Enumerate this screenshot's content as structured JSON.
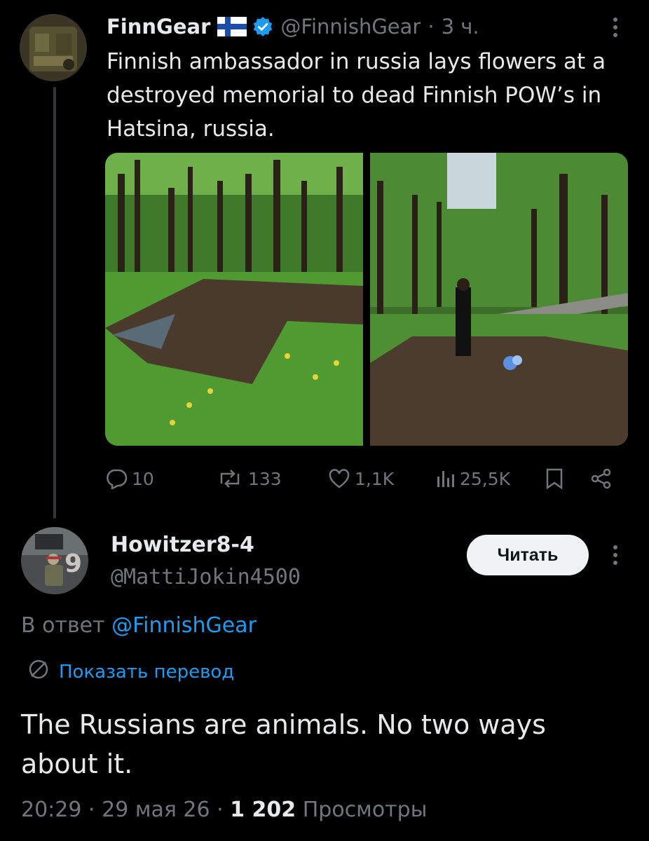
{
  "tweet": {
    "author_name": "FinnGear",
    "handle": "@FinnishGear",
    "time": "3 ч.",
    "separator": "·",
    "text": "Finnish ambassador in russia lays flowers at a destroyed memorial to dead Finnish POW’s in Hatsina, russia.",
    "stats": {
      "replies": "10",
      "reposts": "133",
      "likes": "1,1K",
      "views": "25,5K"
    }
  },
  "reply": {
    "author_name": "Howitzer8-4",
    "handle": "@MattiJokin4500",
    "follow_label": "Читать",
    "reply_prefix": "В ответ",
    "reply_to_handle": "@FinnishGear",
    "show_translation_label": "Показать перевод",
    "text": "The Russians are animals. No two ways about it.",
    "time": "20:29",
    "date": "29 мая 26",
    "views_count": "1 202",
    "views_label": "Просмотры",
    "separator": "·"
  },
  "icons": {
    "more": "more-dots-icon",
    "verified": "verified-badge-icon",
    "flag": "finland-flag-icon",
    "reply": "reply-bubble-icon",
    "repost": "repost-icon",
    "like": "heart-icon",
    "views": "views-bars-icon",
    "bookmark": "bookmark-icon",
    "share": "share-icon",
    "translate": "translate-globe-icon"
  },
  "colors": {
    "background": "#000000",
    "text_primary": "#e7e9ea",
    "text_secondary": "#71767b",
    "accent": "#1d9bf0",
    "follow_button_bg": "#eff3f4"
  }
}
